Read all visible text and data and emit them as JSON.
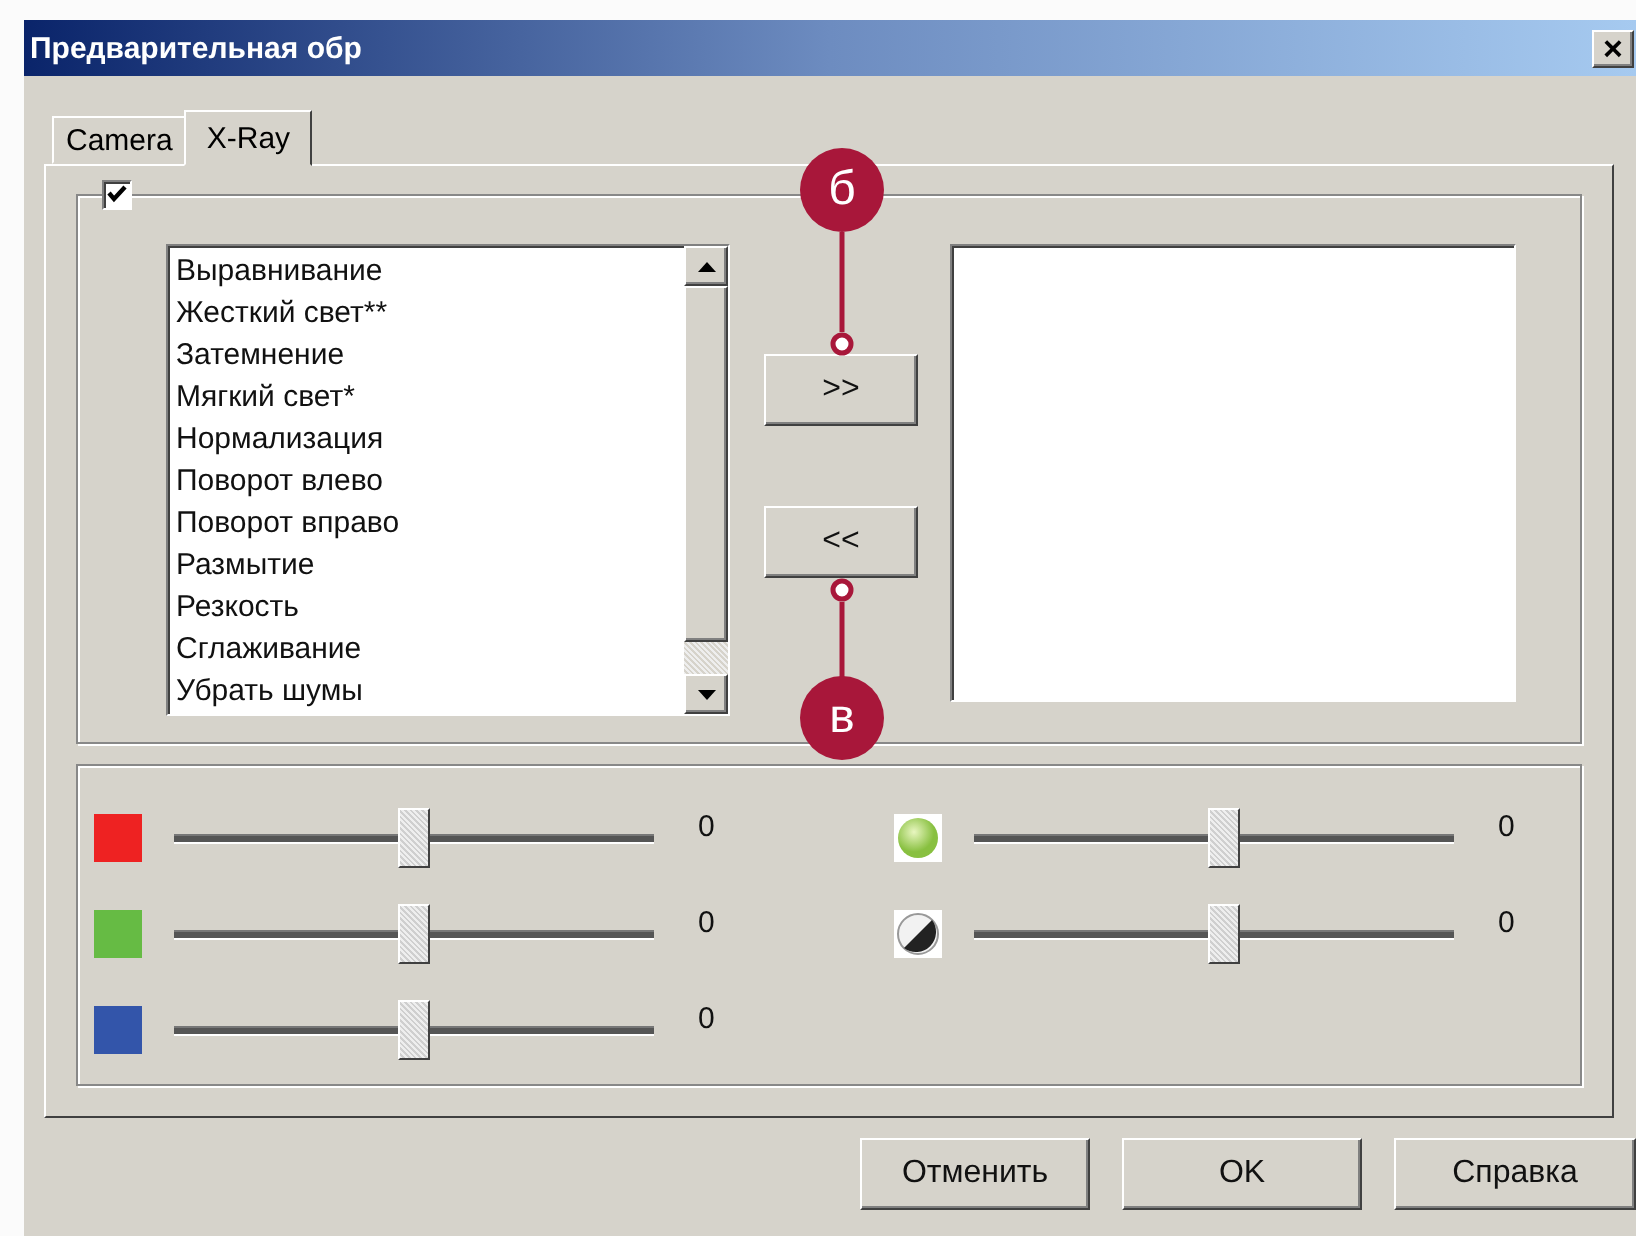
{
  "window": {
    "title": "Предварительная обр",
    "close": "×"
  },
  "tabs": [
    {
      "label": "Camera",
      "selected": false
    },
    {
      "label": "X-Ray",
      "selected": true
    }
  ],
  "filters": {
    "checked": true,
    "available": [
      "Выравнивание",
      "Жесткий свет**",
      "Затемнение",
      "Мягкий свет*",
      "Нормализация",
      "Поворот влево",
      "Поворот вправо",
      "Размытие",
      "Резкость",
      "Сглаживание",
      "Убрать шумы"
    ],
    "add_button": ">>",
    "remove_button": "<<"
  },
  "adjustments": [
    {
      "kind": "color",
      "color": "#ee2222",
      "level": 0.5,
      "reading": "0"
    },
    {
      "kind": "color",
      "color": "#66bb44",
      "level": 0.5,
      "reading": "0"
    },
    {
      "kind": "color",
      "color": "#3355aa",
      "level": 0.5,
      "reading": "0"
    },
    {
      "kind": "brightness",
      "level": 0.52,
      "reading": "0"
    },
    {
      "kind": "contrast",
      "level": 0.52,
      "reading": "0"
    }
  ],
  "annotations": [
    {
      "label": "б"
    },
    {
      "label": "в"
    }
  ],
  "dialog_buttons": [
    "Отменить",
    "OK",
    "Справка"
  ]
}
